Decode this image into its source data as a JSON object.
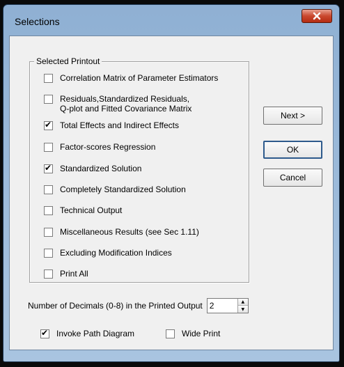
{
  "window": {
    "title": "Selections",
    "close_icon": "close-icon"
  },
  "group": {
    "legend": "Selected Printout",
    "options": [
      {
        "label": "Correlation Matrix of Parameter Estimators",
        "checked": false
      },
      {
        "label": "Residuals,Standardized Residuals,\nQ-plot and Fitted Covariance Matrix",
        "checked": false
      },
      {
        "label": "Total Effects and Indirect Effects",
        "checked": true
      },
      {
        "label": "Factor-scores Regression",
        "checked": false
      },
      {
        "label": "Standardized Solution",
        "checked": true
      },
      {
        "label": "Completely Standardized Solution",
        "checked": false
      },
      {
        "label": "Technical Output",
        "checked": false
      },
      {
        "label": "Miscellaneous Results (see Sec 1.11)",
        "checked": false
      },
      {
        "label": "Excluding Modification Indices",
        "checked": false
      },
      {
        "label": "Print All",
        "checked": false
      }
    ]
  },
  "buttons": {
    "next": "Next >",
    "ok": "OK",
    "cancel": "Cancel"
  },
  "decimals": {
    "label": "Number of Decimals (0-8) in the Printed Output",
    "value": "2"
  },
  "bottom": {
    "path_diagram": {
      "label": "Invoke Path Diagram",
      "checked": true
    },
    "wide_print": {
      "label": "Wide Print",
      "checked": false
    }
  },
  "colors": {
    "titlebar": "#a9c4e0",
    "close": "#c9482e",
    "face": "#f0f0f0"
  }
}
